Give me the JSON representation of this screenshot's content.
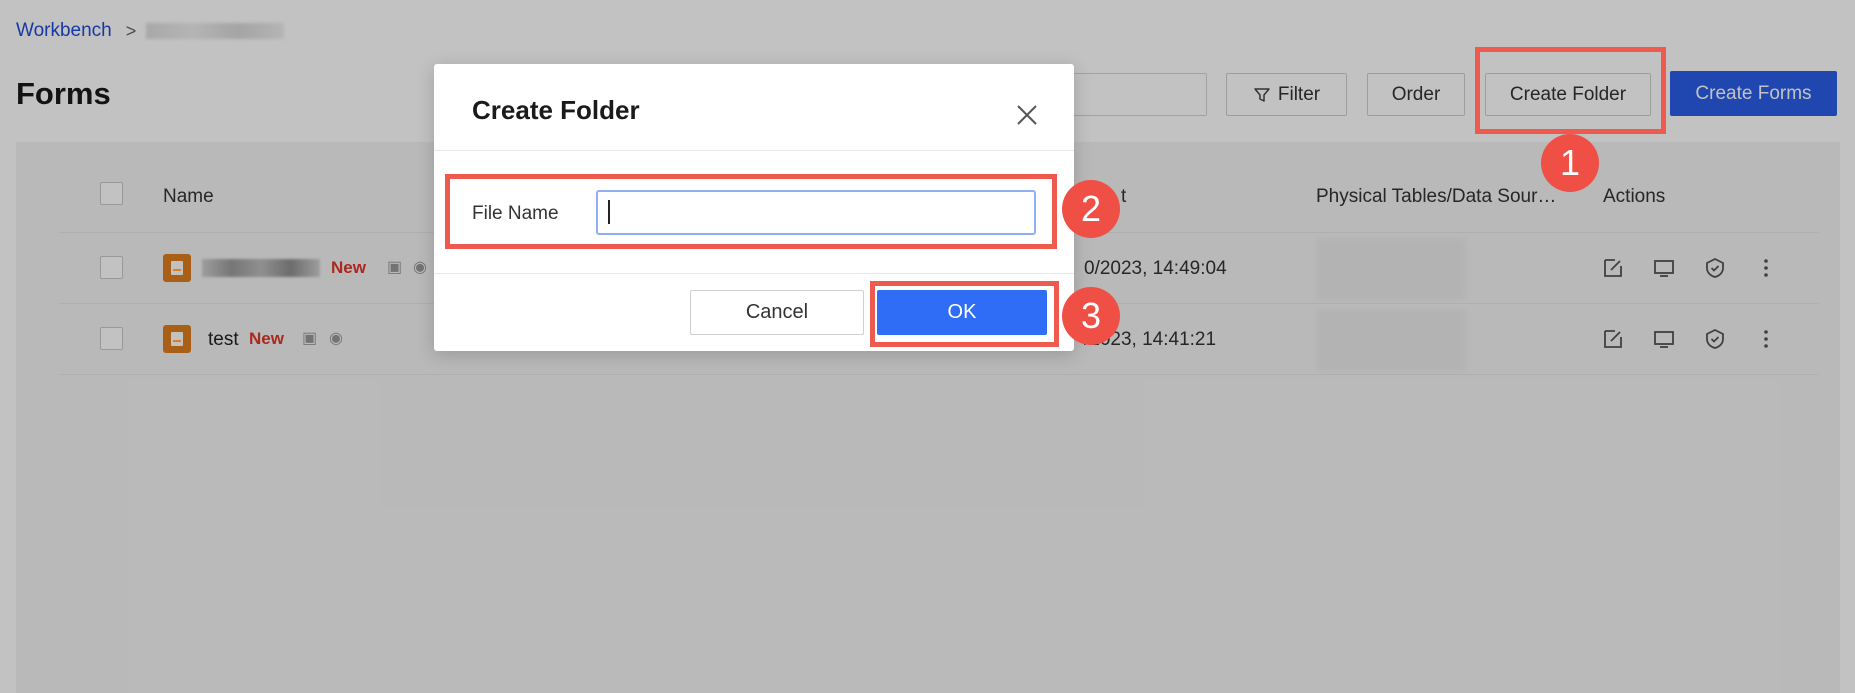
{
  "breadcrumb": {
    "root": "Workbench",
    "separator": ">"
  },
  "page": {
    "title": "Forms"
  },
  "toolbar": {
    "filter_label": "Filter",
    "order_label": "Order",
    "create_folder_label": "Create Folder",
    "create_forms_label": "Create Forms"
  },
  "table": {
    "columns": {
      "name": "Name",
      "last_edit_suffix": "t",
      "physical_tables": "Physical Tables/Data Sour…",
      "actions": "Actions"
    },
    "rows": [
      {
        "name": "",
        "new_badge": "New",
        "date": "0/2023, 14:49:04"
      },
      {
        "name": "test",
        "new_badge": "New",
        "date": "/2023, 14:41:21"
      }
    ]
  },
  "dialog": {
    "title": "Create Folder",
    "field_label": "File Name",
    "field_value": "",
    "cancel_label": "Cancel",
    "ok_label": "OK"
  },
  "callouts": [
    "1",
    "2",
    "3"
  ],
  "colors": {
    "primary": "#2b5ce6",
    "ok_button": "#2f6df6",
    "callout": "#ef5a4e",
    "doc_icon": "#e07d1f",
    "new_badge": "#e0352b",
    "link": "#1f4bd8"
  }
}
